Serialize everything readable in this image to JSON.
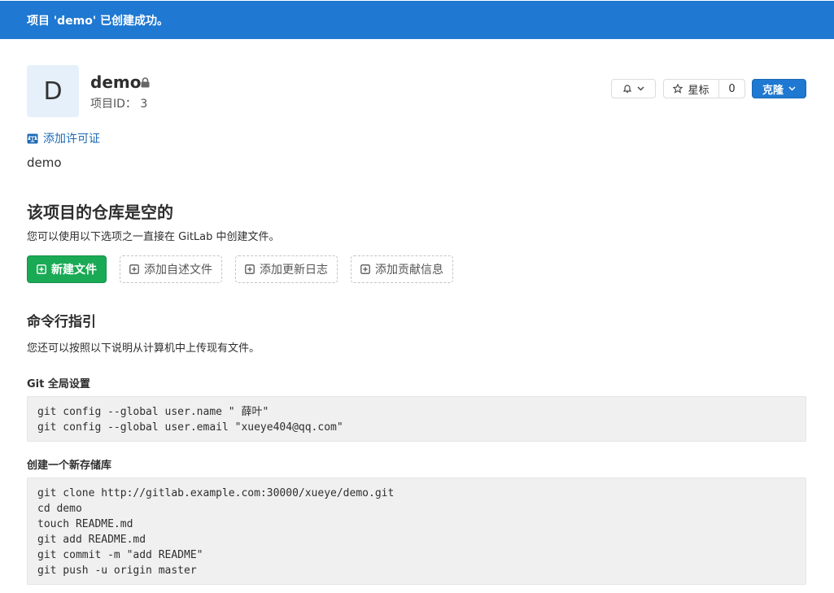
{
  "flash": {
    "message": "项目 'demo' 已创建成功。"
  },
  "project": {
    "avatar_letter": "D",
    "name": "demo",
    "id_label": "项目ID：",
    "id_value": "3",
    "license_link": "添加许可证",
    "description": "demo"
  },
  "header_buttons": {
    "star_label": "星标",
    "star_count": "0",
    "clone_label": "克隆"
  },
  "empty_repo": {
    "title": "该项目的仓库是空的",
    "subtitle": "您可以使用以下选项之一直接在 GitLab 中创建文件。",
    "buttons": {
      "new_file": "新建文件",
      "add_readme": "添加自述文件",
      "add_changelog": "添加更新日志",
      "add_contributing": "添加贡献信息"
    }
  },
  "cli": {
    "title": "命令行指引",
    "subtitle": "您还可以按照以下说明从计算机中上传现有文件。",
    "global_setup": {
      "label": "Git 全局设置",
      "lines": [
        "git config --global user.name \" 薛叶\"",
        "git config --global user.email \"xueye404@qq.com\""
      ]
    },
    "new_repo": {
      "label": "创建一个新存储库",
      "lines": [
        "git clone http://gitlab.example.com:30000/xueye/demo.git",
        "cd demo",
        "touch README.md",
        "git add README.md",
        "git commit -m \"add README\"",
        "git push -u origin master"
      ]
    }
  },
  "icons": {
    "lock": "lock-icon",
    "bell": "bell-icon",
    "chevron": "chevron-down-icon",
    "star": "star-icon",
    "license": "scale-icon",
    "plus_square": "plus-square-icon"
  },
  "colors": {
    "flash_bg": "#1f78d1",
    "primary": "#1f78d1",
    "success": "#1aaa55",
    "link": "#1b69b6",
    "avatar_bg": "#e6f0fb",
    "code_bg": "#f0f0f0"
  }
}
